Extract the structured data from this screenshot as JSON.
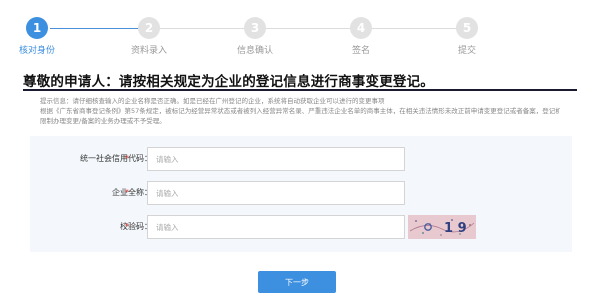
{
  "stepper": {
    "steps": [
      {
        "number": "1",
        "label": "核对身份",
        "active": true
      },
      {
        "number": "2",
        "label": "资料录入",
        "active": false
      },
      {
        "number": "3",
        "label": "信息确认",
        "active": false
      },
      {
        "number": "4",
        "label": "签名",
        "active": false
      },
      {
        "number": "5",
        "label": "提交",
        "active": false
      }
    ]
  },
  "page": {
    "title": "尊敬的申请人：请按相关规定为企业的登记信息进行商事变更登记。",
    "hint_line1": "提示信息：请仔细核查输入的企业名称是否正确。如是已经在广州登记的企业，系统将自动获取企业可以进行的变更事项",
    "hint_line2": "根据《广东省商事登记条例》第57条规定，被标记为经营异常状态或者被列入经营异常名录、严重违法企业名单的商事主体，在相关违法情形未改正前申请变更登记或者备案，登记机关将",
    "hint_line3": "限制办理变更/备案的业务办理或不予受理。"
  },
  "form": {
    "required_mark": "*",
    "credit_code": {
      "label": "统一社会信用代码：",
      "placeholder": "请输入",
      "value": ""
    },
    "company_name": {
      "label": "企业全称：",
      "placeholder": "请输入",
      "value": ""
    },
    "captcha": {
      "label": "校验码：",
      "placeholder": "请输入",
      "value": "",
      "image_text": "1 9"
    }
  },
  "actions": {
    "next_label": "下一步"
  },
  "colors": {
    "accent": "#3d8fe0",
    "inactive_step": "#e2e2e2",
    "required": "#e23b3b",
    "panel_bg": "#f4f8fc"
  }
}
